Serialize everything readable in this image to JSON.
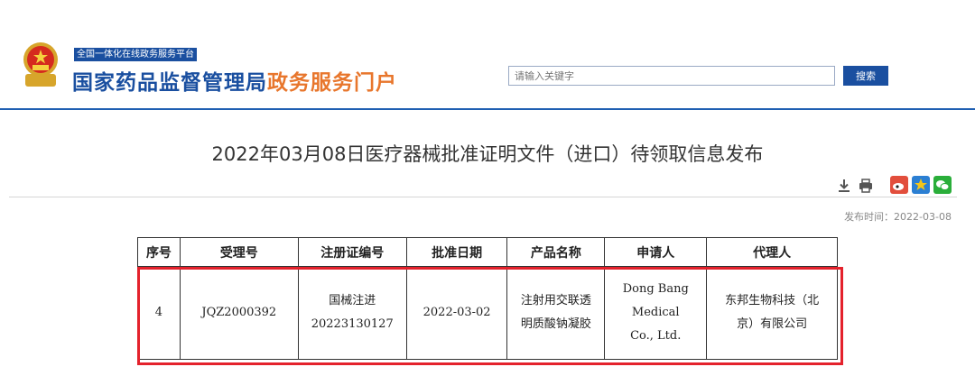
{
  "header": {
    "platform_label": "全国一体化在线政务服务平台",
    "site_name_main": "国家药品监督管理局",
    "site_name_accent": "政务服务门户",
    "search_placeholder": "请输入关键字",
    "search_button": "搜索"
  },
  "article": {
    "title": "2022年03月08日医疗器械批准证明文件（进口）待领取信息发布",
    "publish_time": "发布时间：2022-03-08"
  },
  "table": {
    "headers": [
      "序号",
      "受理号",
      "注册证编号",
      "批准日期",
      "产品名称",
      "申请人",
      "代理人"
    ],
    "row": {
      "index": "4",
      "acceptance_no": "JQZ2000392",
      "registration_no": "国械注进 20223130127",
      "approval_date": "2022-03-02",
      "product_name": "注射用交联透明质酸钠凝胶",
      "applicant": "Dong Bang Medical Co., Ltd.",
      "agent": "东邦生物科技（北京）有限公司"
    }
  },
  "colors": {
    "brand_blue": "#1a4fa0",
    "accent_orange": "#e8762c",
    "highlight_red": "#e4222c"
  },
  "icons": [
    "national-emblem-icon",
    "download-icon",
    "print-icon",
    "weibo-icon",
    "favorite-icon",
    "wechat-icon"
  ]
}
